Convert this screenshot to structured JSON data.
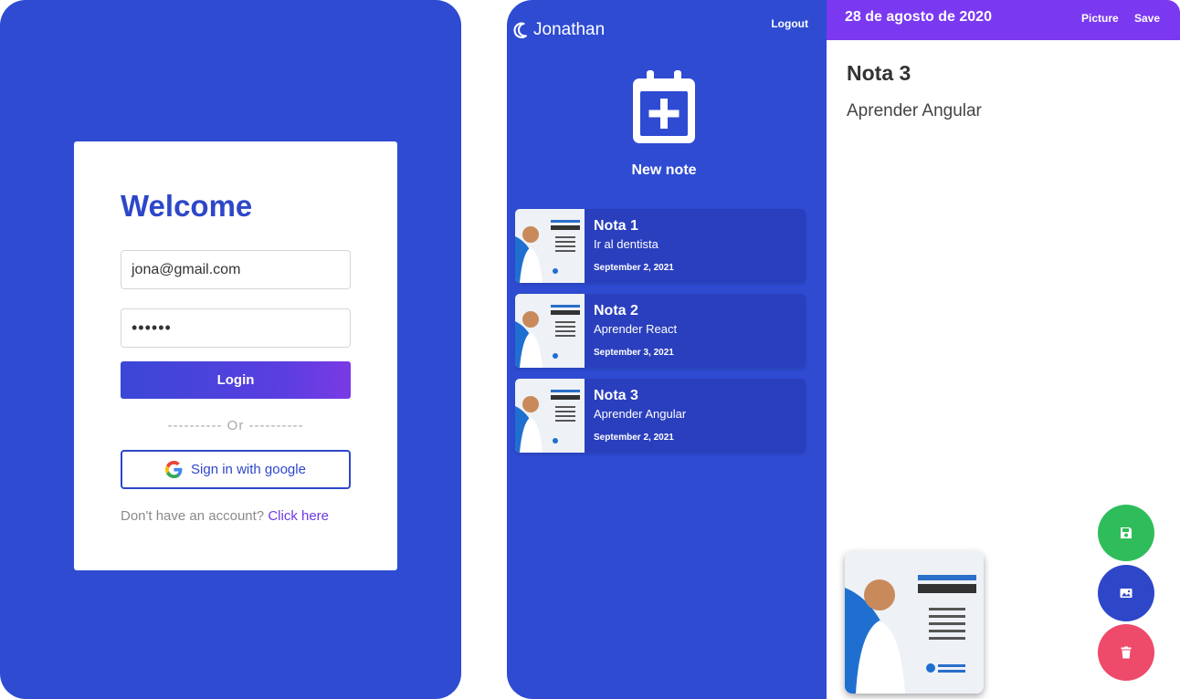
{
  "login": {
    "title": "Welcome",
    "email_value": "jona@gmail.com",
    "password_value": "••••••",
    "login_label": "Login",
    "divider": "---------- Or ----------",
    "google_label": "Sign in with google",
    "account_prompt": "Don't have an account?",
    "account_link": "Click here"
  },
  "sidebar": {
    "username": "Jonathan",
    "logout_label": "Logout",
    "new_note_label": "New note",
    "entries": [
      {
        "title": "Nota 1",
        "body": "Ir al dentista",
        "date": "September 2, 2021"
      },
      {
        "title": "Nota 2",
        "body": "Aprender React",
        "date": "September 3, 2021"
      },
      {
        "title": "Nota 3",
        "body": "Aprender Angular",
        "date": "September 2, 2021"
      }
    ]
  },
  "editor": {
    "date": "28 de agosto de 2020",
    "picture_label": "Picture",
    "save_label": "Save",
    "note_title": "Nota 3",
    "note_body": "Aprender Angular"
  },
  "icons": {
    "moon": "moon-icon",
    "calendar": "calendar-plus-icon",
    "google": "google-icon",
    "save": "floppy-disk-icon",
    "picture": "image-icon",
    "delete": "trash-icon"
  },
  "colors": {
    "primary_blue": "#2e4bd2",
    "accent_purple": "#7a39f0",
    "save_green": "#2fbd5b",
    "delete_red": "#ee4a6a"
  }
}
